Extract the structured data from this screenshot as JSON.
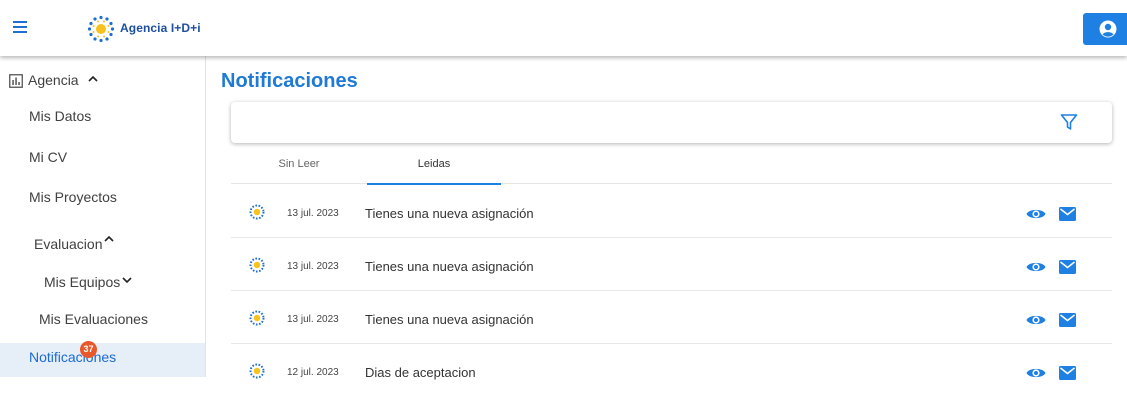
{
  "header": {
    "brand": "Agencia I+D+i",
    "menu_icon": "menu-icon",
    "user_icon": "user-icon",
    "accent": "#1e80e3"
  },
  "sidebar": {
    "items": [
      {
        "label": "Agencia",
        "icon": "chart-icon",
        "expanded": true
      },
      {
        "label": "Mis Datos"
      },
      {
        "label": "Mi CV"
      },
      {
        "label": "Mis Proyectos"
      },
      {
        "label": "Evaluacion",
        "expanded": true
      },
      {
        "label": "Mis Equipos",
        "expanded": false
      },
      {
        "label": "Mis Evaluaciones"
      },
      {
        "label": "Notificaciones",
        "badge": "37",
        "active": true
      }
    ]
  },
  "main": {
    "title": "Notificaciones",
    "filter_icon": "filter-icon",
    "tabs": [
      {
        "label": "Sin Leer",
        "active": false
      },
      {
        "label": "Leidas",
        "active": true
      }
    ],
    "notifications": [
      {
        "date": "13 jul. 2023",
        "message": "Tienes una nueva asignación"
      },
      {
        "date": "13 jul. 2023",
        "message": "Tienes una nueva asignación"
      },
      {
        "date": "13 jul. 2023",
        "message": "Tienes una nueva asignación"
      },
      {
        "date": "12 jul. 2023",
        "message": "Dias de aceptacion"
      }
    ]
  }
}
